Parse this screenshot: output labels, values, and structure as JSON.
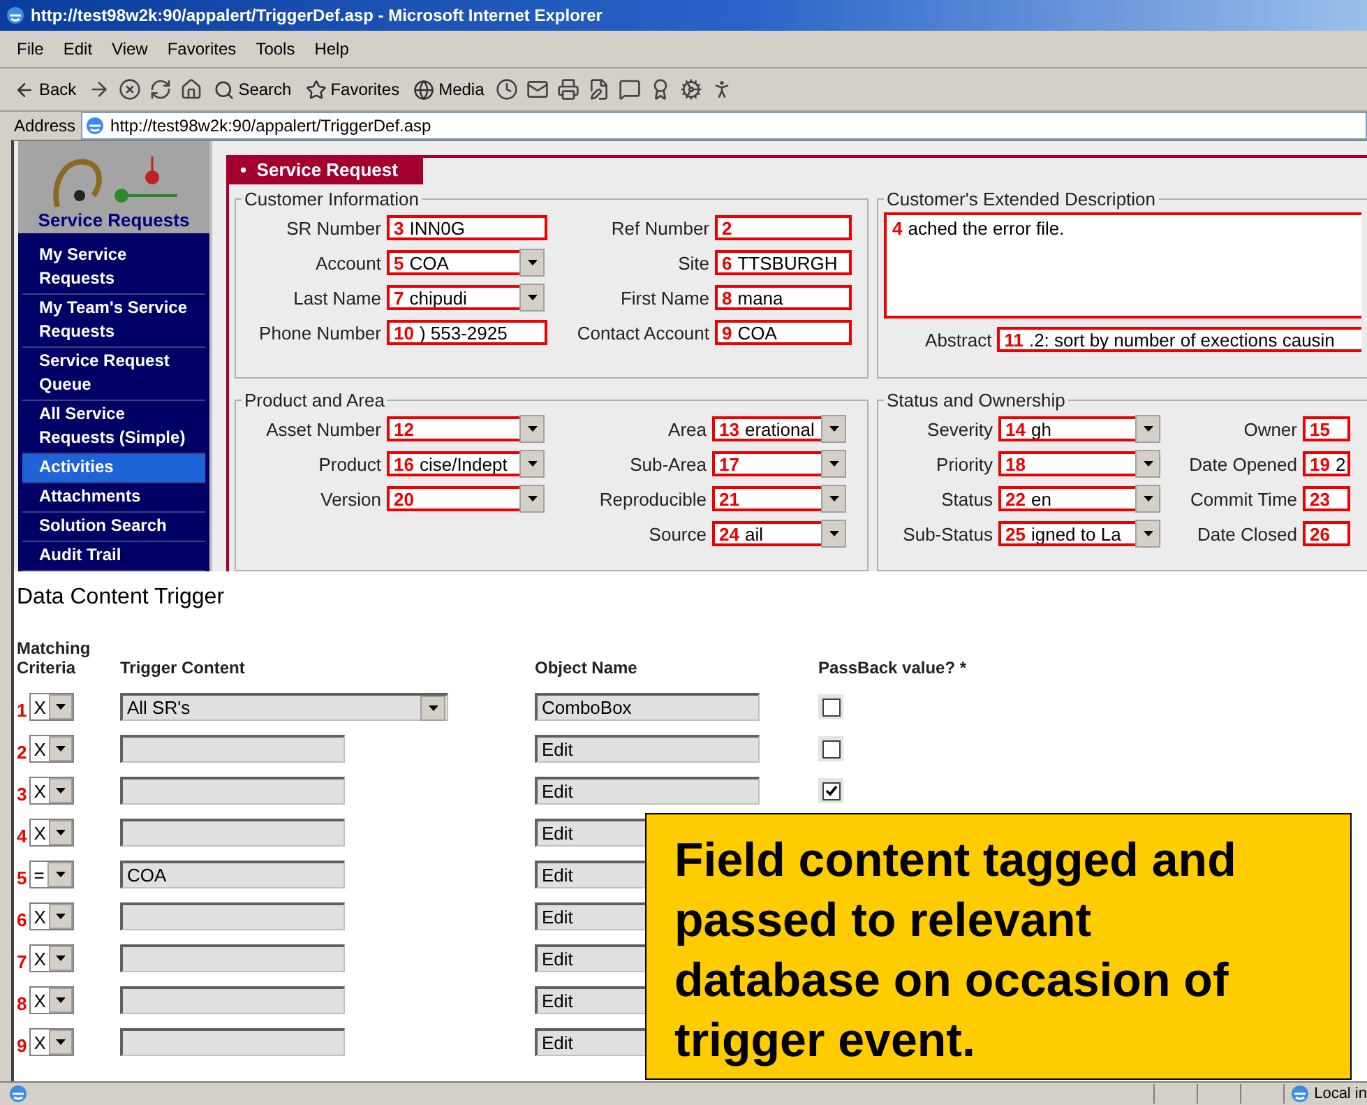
{
  "window": {
    "title": "http://test98w2k:90/appalert/TriggerDef.asp - Microsoft Internet Explorer"
  },
  "menu": [
    "File",
    "Edit",
    "View",
    "Favorites",
    "Tools",
    "Help"
  ],
  "toolbar": [
    {
      "kind": "back",
      "label": "Back"
    },
    {
      "kind": "forward"
    },
    {
      "kind": "stop"
    },
    {
      "kind": "refresh"
    },
    {
      "kind": "home"
    },
    {
      "kind": "search",
      "label": "Search"
    },
    {
      "kind": "favorites",
      "label": "Favorites"
    },
    {
      "kind": "media",
      "label": "Media"
    },
    {
      "kind": "history"
    },
    {
      "kind": "mail"
    },
    {
      "kind": "print"
    },
    {
      "kind": "edit"
    },
    {
      "kind": "discuss"
    },
    {
      "kind": "messenger"
    },
    {
      "kind": "tool"
    },
    {
      "kind": "person"
    }
  ],
  "address": {
    "label": "Address",
    "value": "http://test98w2k:90/appalert/TriggerDef.asp"
  },
  "sidebar": {
    "title": "Service Requests",
    "items": [
      {
        "label": "My Service Requests",
        "selected": false
      },
      {
        "label": "My Team's Service Requests",
        "selected": false
      },
      {
        "label": "Service Request Queue",
        "selected": false
      },
      {
        "label": "All Service Requests (Simple)",
        "selected": false
      },
      {
        "label": "Activities",
        "selected": true
      },
      {
        "label": "Attachments",
        "selected": false
      },
      {
        "label": "Solution Search",
        "selected": false
      },
      {
        "label": "Audit Trail",
        "selected": false
      }
    ]
  },
  "form": {
    "tab": {
      "bullet": "•",
      "label": "Service Request"
    },
    "groups": [
      {
        "kind": "fields",
        "title": "Customer Information",
        "columns": [
          [
            {
              "label": "SR Number",
              "tag": "3",
              "value": "INN0G",
              "dropdown": false
            },
            {
              "label": "Account",
              "tag": "5",
              "value": "COA",
              "dropdown": true
            },
            {
              "label": "Last Name",
              "tag": "7",
              "value": "chipudi",
              "dropdown": true
            },
            {
              "label": "Phone Number",
              "tag": "10",
              "value": ") 553-2925",
              "dropdown": false
            }
          ],
          [
            {
              "label": "Ref Number",
              "tag": "2",
              "dropdown": false
            },
            {
              "label": "Site",
              "tag": "6",
              "value": "TTSBURGH",
              "dropdown": false
            },
            {
              "label": "First Name",
              "tag": "8",
              "value": "mana",
              "dropdown": false
            },
            {
              "label": "Contact Account",
              "tag": "9",
              "value": "COA",
              "dropdown": false
            }
          ]
        ]
      },
      {
        "kind": "description",
        "title": "Customer's Extended Description",
        "text": {
          "tag": "4",
          "value": "ached the error file."
        },
        "abstract": {
          "label": "Abstract",
          "tag": "11",
          "value": ".2:  sort by number of exections causin"
        }
      },
      {
        "kind": "fields",
        "title": "Product and Area",
        "columns": [
          [
            {
              "label": "Asset Number",
              "tag": "12",
              "dropdown": true
            },
            {
              "label": "Product",
              "tag": "16",
              "value": "cise/Indept",
              "dropdown": true
            },
            {
              "label": "Version",
              "tag": "20",
              "dropdown": true
            }
          ],
          [
            {
              "label": "Area",
              "tag": "13",
              "value": "erational",
              "dropdown": true
            },
            {
              "label": "Sub-Area",
              "tag": "17",
              "dropdown": true
            },
            {
              "label": "Reproducible",
              "tag": "21",
              "dropdown": true
            },
            {
              "label": "Source",
              "tag": "24",
              "value": "ail",
              "dropdown": true
            }
          ]
        ]
      },
      {
        "kind": "fields",
        "title": "Status and Ownership",
        "columns": [
          [
            {
              "label": "Severity",
              "tag": "14",
              "value": "gh",
              "dropdown": true
            },
            {
              "label": "Priority",
              "tag": "18",
              "dropdown": true
            },
            {
              "label": "Status",
              "tag": "22",
              "value": "en",
              "dropdown": true
            },
            {
              "label": "Sub-Status",
              "tag": "25",
              "value": "igned to La",
              "dropdown": true
            }
          ],
          [
            {
              "label": "Owner",
              "tag": "15",
              "dropdown": false
            },
            {
              "label": "Date Opened",
              "tag": "19",
              "value": "2",
              "dropdown": false
            },
            {
              "label": "Commit Time",
              "tag": "23",
              "dropdown": false
            },
            {
              "label": "Date Closed",
              "tag": "26",
              "dropdown": false
            }
          ]
        ]
      }
    ]
  },
  "trigger": {
    "title": "Data Content Trigger",
    "columns": [
      "Matching Criteria",
      "Trigger Content",
      "Object Name",
      "PassBack value? *"
    ],
    "rows": [
      {
        "number": "1",
        "criteria": "X",
        "kind": "select",
        "content": "All SR's",
        "object": "ComboBox",
        "passback": false
      },
      {
        "number": "2",
        "criteria": "X",
        "kind": "text",
        "object": "Edit",
        "passback": false
      },
      {
        "number": "3",
        "criteria": "X",
        "kind": "text",
        "object": "Edit",
        "passback": true
      },
      {
        "number": "4",
        "criteria": "X",
        "kind": "text",
        "object": "Edit"
      },
      {
        "number": "5",
        "criteria": "=",
        "kind": "text",
        "content": "COA",
        "object": "Edit"
      },
      {
        "number": "6",
        "criteria": "X",
        "kind": "text",
        "object": "Edit"
      },
      {
        "number": "7",
        "criteria": "X",
        "kind": "text",
        "object": "Edit"
      },
      {
        "number": "8",
        "criteria": "X",
        "kind": "text",
        "object": "Edit"
      },
      {
        "number": "9",
        "criteria": "X",
        "kind": "text",
        "object": "Edit"
      }
    ]
  },
  "callout": {
    "text": "Field content tagged and passed to relevant database on occasion of trigger event."
  },
  "status_bar": {
    "zone": "Local in"
  }
}
